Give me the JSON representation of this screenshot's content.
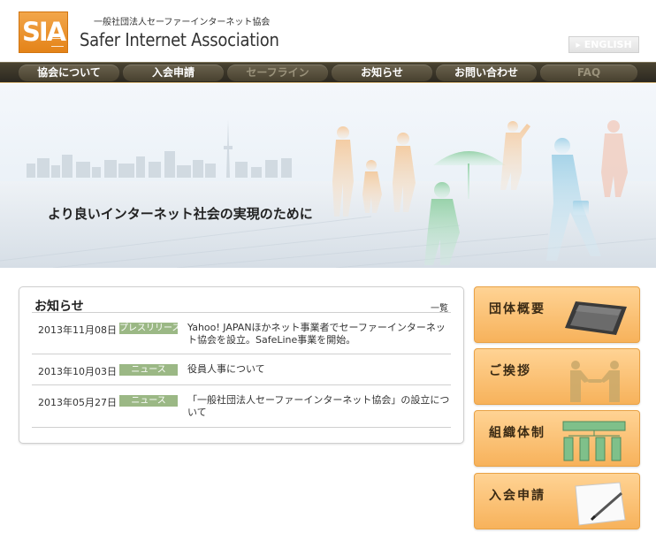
{
  "header": {
    "logo_text": "SIA",
    "org_name_jp": "一般社団法人セーファーインターネット協会",
    "org_name_en": "Safer Internet Association",
    "english_button": "ENGLISH"
  },
  "nav": {
    "items": [
      {
        "label": "協会について",
        "enabled": true
      },
      {
        "label": "入会申請",
        "enabled": true
      },
      {
        "label": "セーフライン",
        "enabled": false
      },
      {
        "label": "お知らせ",
        "enabled": true
      },
      {
        "label": "お問い合わせ",
        "enabled": true
      },
      {
        "label": "FAQ",
        "enabled": false
      }
    ]
  },
  "hero": {
    "tagline": "より良いインターネット社会の実現のために"
  },
  "news": {
    "title": "お知らせ",
    "view_all": "一覧",
    "items": [
      {
        "date": "2013年11月08日",
        "category": "プレスリリース",
        "text": "Yahoo! JAPANほかネット事業者でセーファーインターネット協会を設立。SafeLine事業を開始。"
      },
      {
        "date": "2013年10月03日",
        "category": "ニュース",
        "text": "役員人事について"
      },
      {
        "date": "2013年05月27日",
        "category": "ニュース",
        "text": "「一般社団法人セーファーインターネット協会」の設立について"
      }
    ]
  },
  "sidebar": {
    "buttons": [
      {
        "label": "団体概要",
        "icon": "tablet-icon"
      },
      {
        "label": "ご挨拶",
        "icon": "handshake-icon"
      },
      {
        "label": "組織体制",
        "icon": "org-chart-icon"
      },
      {
        "label": "入会申請",
        "icon": "document-pen-icon"
      }
    ]
  },
  "colors": {
    "accent_orange": "#f7b25b",
    "nav_bg": "#3a3428",
    "badge_green": "#9bb885"
  }
}
